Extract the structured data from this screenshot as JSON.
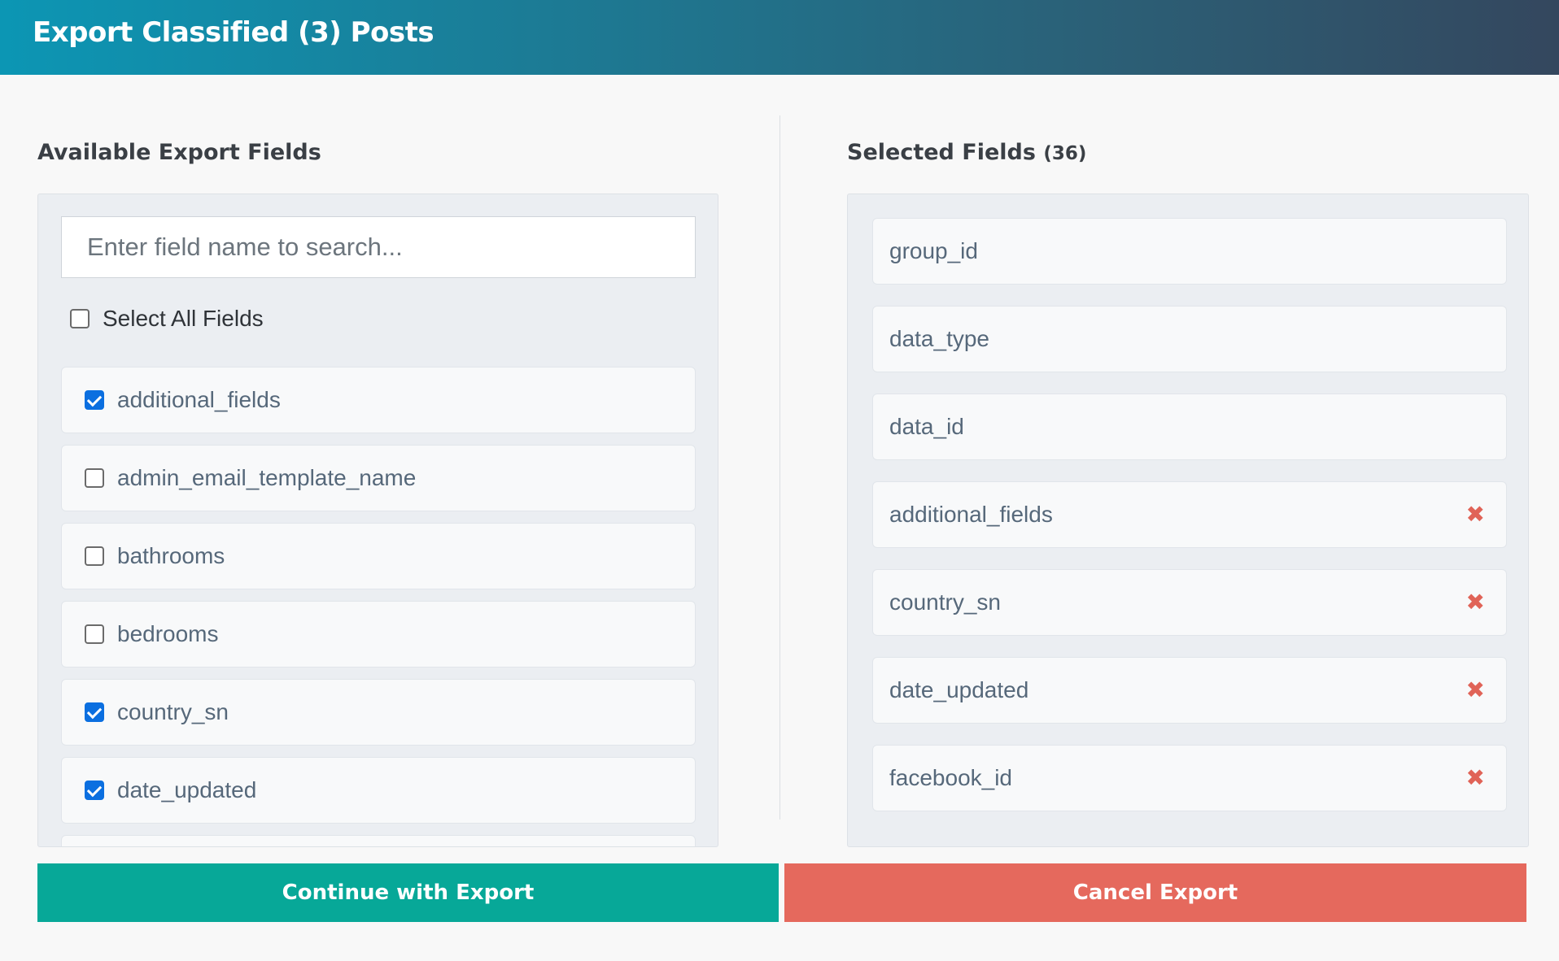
{
  "header": {
    "title": "Export Classified (3) Posts"
  },
  "available": {
    "title": "Available Export Fields",
    "search_placeholder": "Enter field name to search...",
    "select_all_label": "Select All Fields",
    "fields": [
      {
        "label": "additional_fields",
        "checked": true
      },
      {
        "label": "admin_email_template_name",
        "checked": false
      },
      {
        "label": "bathrooms",
        "checked": false
      },
      {
        "label": "bedrooms",
        "checked": false
      },
      {
        "label": "country_sn",
        "checked": true
      },
      {
        "label": "date_updated",
        "checked": true
      }
    ]
  },
  "selected": {
    "title": "Selected Fields",
    "count": "(36)",
    "fields": [
      {
        "label": "group_id",
        "removable": false
      },
      {
        "label": "data_type",
        "removable": false
      },
      {
        "label": "data_id",
        "removable": false
      },
      {
        "label": "additional_fields",
        "removable": true
      },
      {
        "label": "country_sn",
        "removable": true
      },
      {
        "label": "date_updated",
        "removable": true
      },
      {
        "label": "facebook_id",
        "removable": true
      }
    ],
    "remove_glyph": "✖"
  },
  "buttons": {
    "continue_label": "Continue with Export",
    "cancel_label": "Cancel Export"
  },
  "colors": {
    "continue": "#07a898",
    "cancel": "#e5695d",
    "remove": "#e06357",
    "checkbox": "#0b6fe0"
  }
}
